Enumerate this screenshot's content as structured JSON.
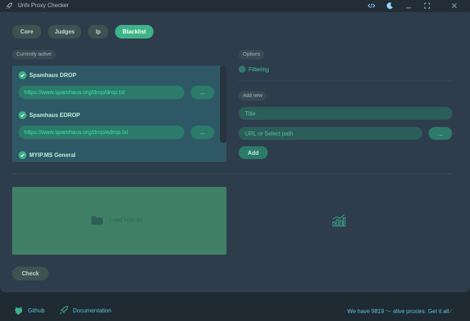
{
  "window": {
    "title": "Unfx Proxy Checker",
    "buttons": [
      "code-icon",
      "moon-icon",
      "minimize-icon",
      "maximize-icon",
      "close-icon"
    ]
  },
  "tabs": [
    {
      "label": "Core",
      "active": false
    },
    {
      "label": "Judges",
      "active": false
    },
    {
      "label": "Ip",
      "active": false
    },
    {
      "label": "Blacklist",
      "active": true
    }
  ],
  "blacklist": {
    "section_label": "Currently active",
    "items": [
      {
        "title": "Spamhaus DROP",
        "url": "https://www.spamhaus.org/drop/drop.txt",
        "browse_label": "...",
        "checked": true
      },
      {
        "title": "Spamhaus EDROP",
        "url": "https://www.spamhaus.org/drop/edrop.txt",
        "browse_label": "...",
        "checked": true
      },
      {
        "title": "MYIP.MS General",
        "checked": true
      }
    ]
  },
  "options": {
    "section_label": "Options",
    "filtering_label": "Filtering"
  },
  "add_new": {
    "section_label": "Add new",
    "title_placeholder": "Title",
    "path_placeholder": "URL or Select path",
    "browse_label": "...",
    "add_label": "Add"
  },
  "load": {
    "label": "Load from txt",
    "icon": "folder-icon"
  },
  "chart_icon": "chart-icon",
  "check_label": "Check",
  "footer": {
    "github_label": "Github",
    "docs_label": "Documentation",
    "status_prefix": "We have",
    "alive_count": "9819",
    "status_suffix": "alive proxies. Get it all"
  },
  "colors": {
    "accent": "#3cb389",
    "panel": "#2e3d4b",
    "background": "#1f2a33",
    "link": "#5ac7d6"
  }
}
